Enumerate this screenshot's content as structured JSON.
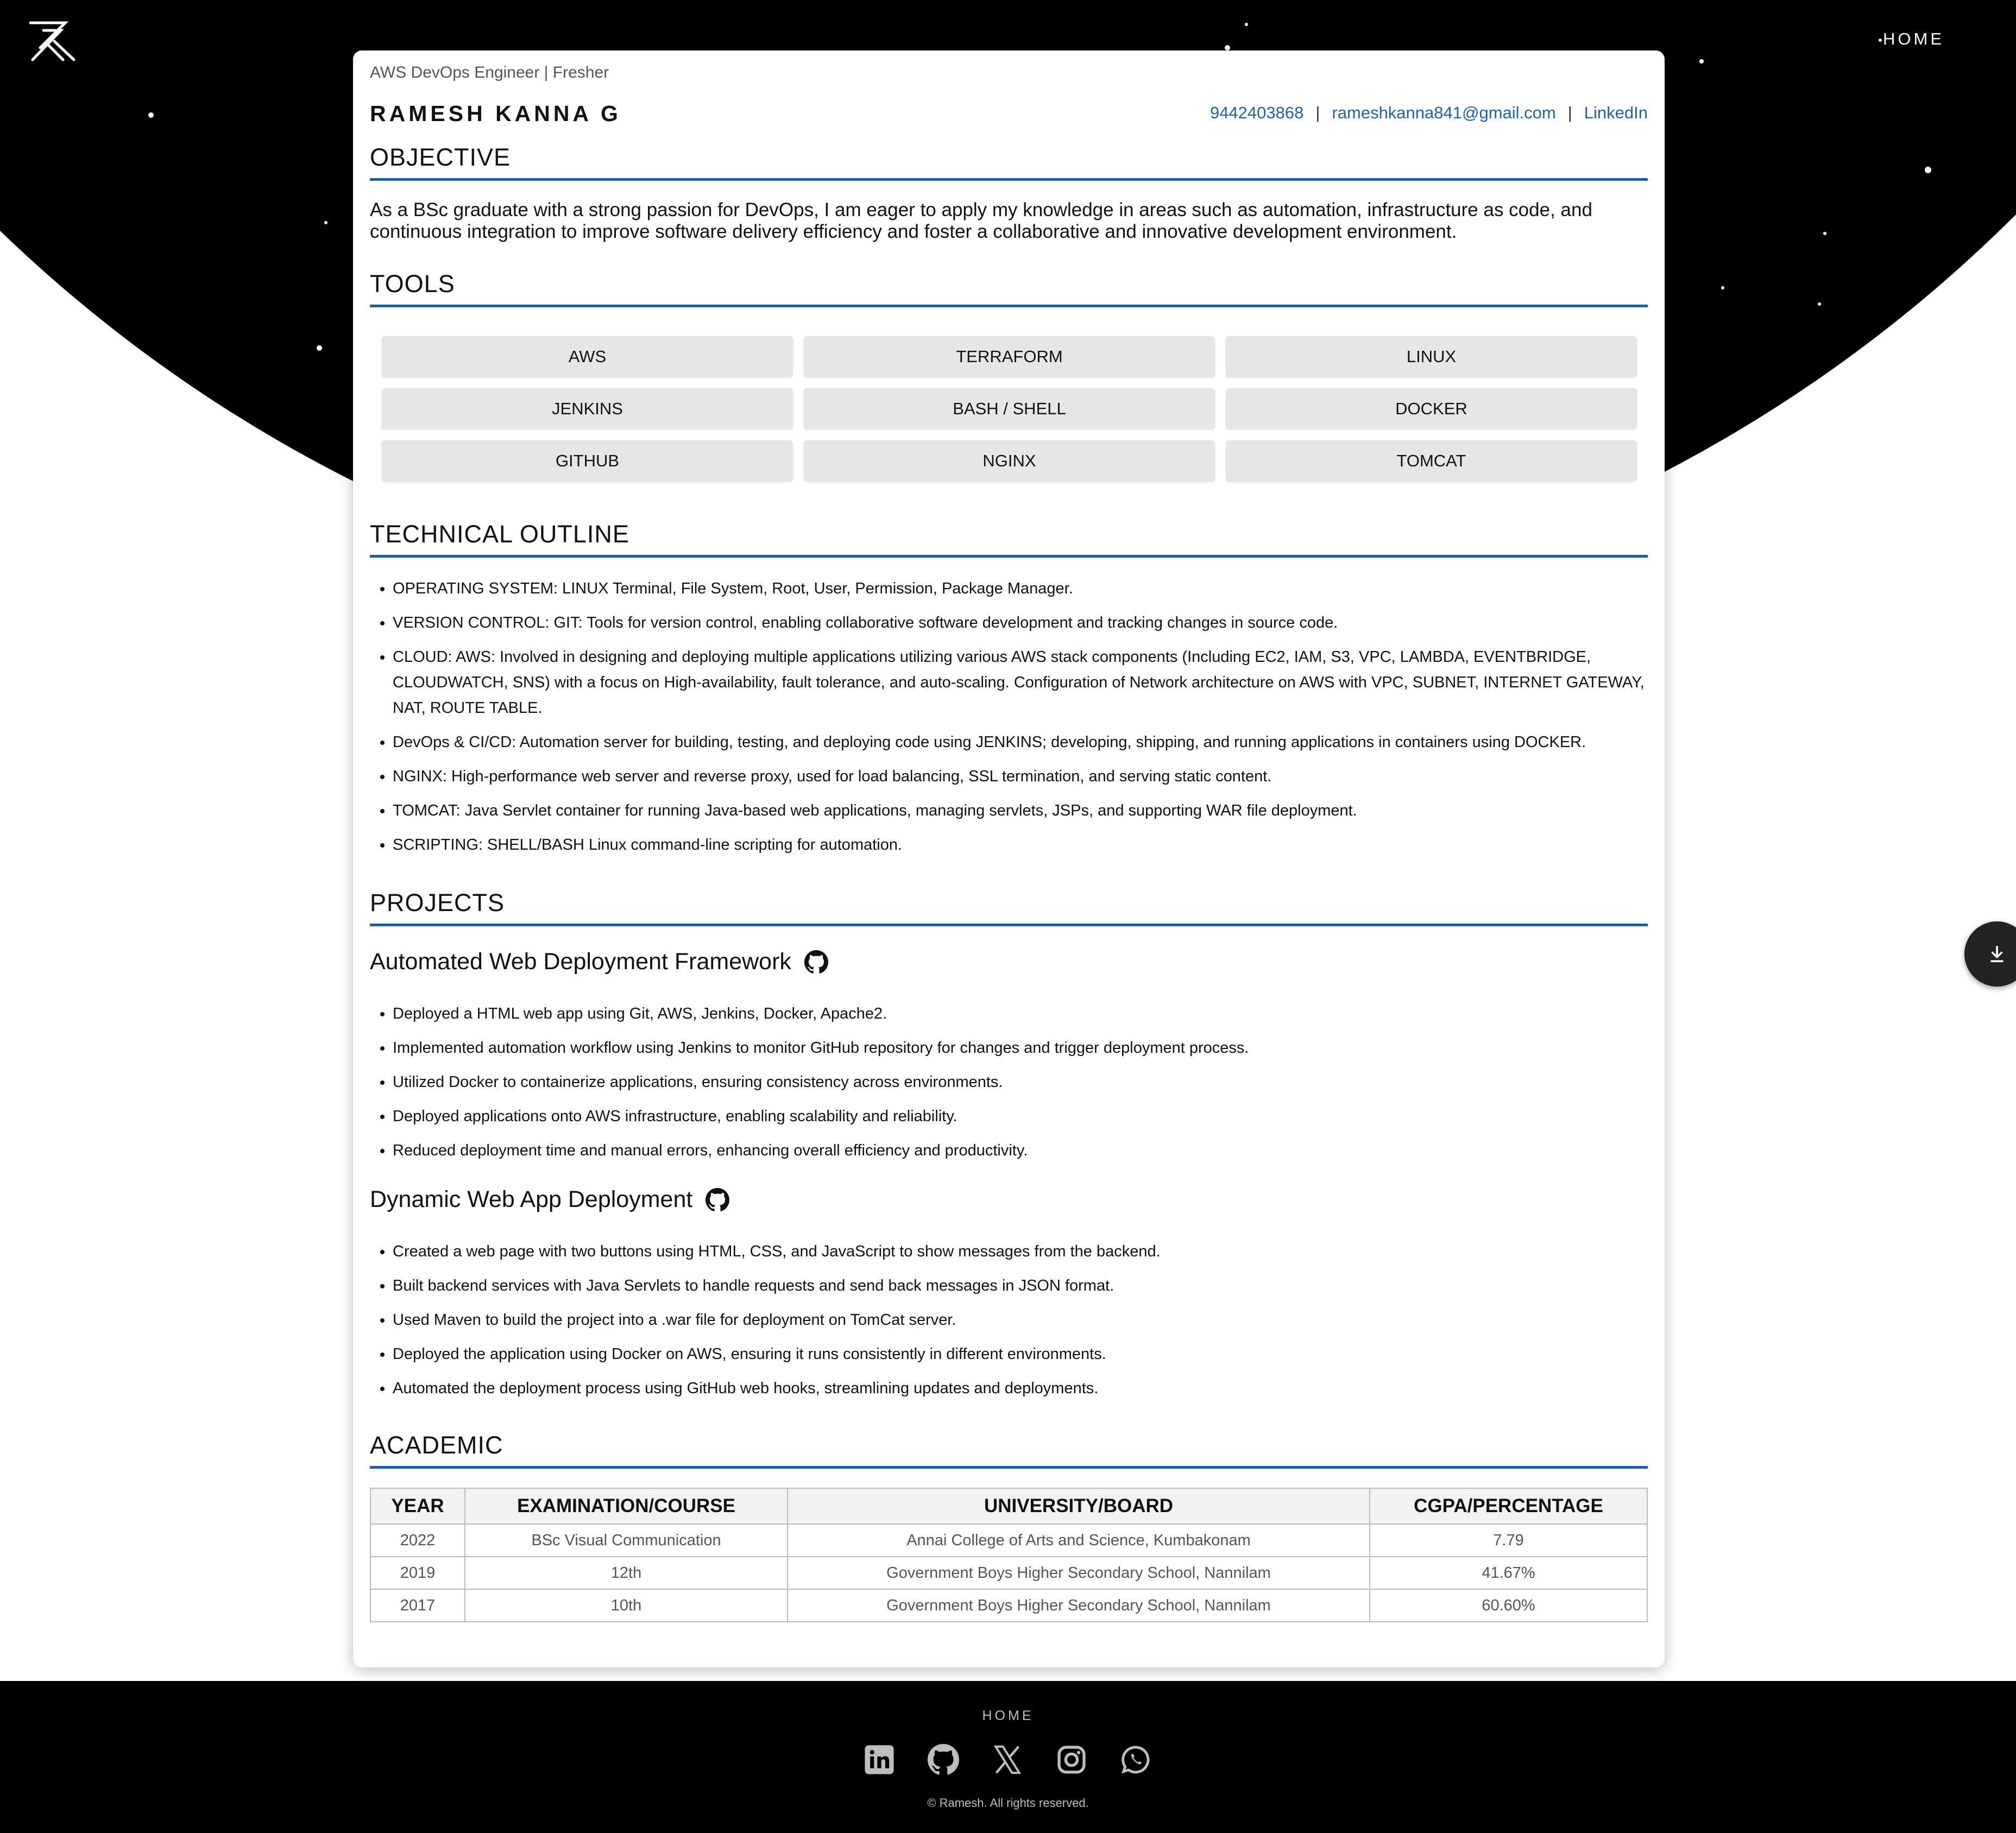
{
  "nav": {
    "home_label": "HOME"
  },
  "header": {
    "role": "AWS DevOps Engineer | Fresher",
    "name": "RAMESH KANNA G",
    "phone": "9442403868",
    "email": "rameshkanna841@gmail.com",
    "linkedin": "LinkedIn",
    "separator": "|"
  },
  "objective": {
    "title": "OBJECTIVE",
    "text": "As a BSc graduate with a strong passion for DevOps, I am eager to apply my knowledge in areas such as automation, infrastructure as code, and continuous integration to improve software delivery efficiency and foster a collaborative and innovative development environment."
  },
  "tools": {
    "title": "TOOLS",
    "items": [
      "AWS",
      "TERRAFORM",
      "LINUX",
      "JENKINS",
      "BASH / SHELL",
      "DOCKER",
      "GITHUB",
      "NGINX",
      "TOMCAT"
    ]
  },
  "technical": {
    "title": "TECHNICAL OUTLINE",
    "items": [
      "OPERATING SYSTEM: LINUX Terminal, File System, Root, User, Permission, Package Manager.",
      "VERSION CONTROL: GIT: Tools for version control, enabling collaborative software development and tracking changes in source code.",
      "CLOUD: AWS: Involved in designing and deploying multiple applications utilizing various AWS stack components (Including EC2, IAM, S3, VPC, LAMBDA, EVENTBRIDGE, CLOUDWATCH, SNS) with a focus on High-availability, fault tolerance, and auto-scaling. Configuration of Network architecture on AWS with VPC, SUBNET, INTERNET GATEWAY, NAT, ROUTE TABLE.",
      "DevOps & CI/CD: Automation server for building, testing, and deploying code using JENKINS; developing, shipping, and running applications in containers using DOCKER.",
      "NGINX: High-performance web server and reverse proxy, used for load balancing, SSL termination, and serving static content.",
      "TOMCAT: Java Servlet container for running Java-based web applications, managing servlets, JSPs, and supporting WAR file deployment.",
      "SCRIPTING: SHELL/BASH Linux command-line scripting for automation."
    ]
  },
  "projects": {
    "title": "PROJECTS",
    "list": [
      {
        "name": "Automated Web Deployment Framework",
        "items": [
          "Deployed a HTML web app using Git, AWS, Jenkins, Docker, Apache2.",
          "Implemented automation workflow using Jenkins to monitor GitHub repository for changes and trigger deployment process.",
          "Utilized Docker to containerize applications, ensuring consistency across environments.",
          "Deployed applications onto AWS infrastructure, enabling scalability and reliability.",
          "Reduced deployment time and manual errors, enhancing overall efficiency and productivity."
        ]
      },
      {
        "name": "Dynamic Web App Deployment",
        "items": [
          "Created a web page with two buttons using HTML, CSS, and JavaScript to show messages from the backend.",
          "Built backend services with Java Servlets to handle requests and send back messages in JSON format.",
          "Used Maven to build the project into a .war file for deployment on TomCat server.",
          "Deployed the application using Docker on AWS, ensuring it runs consistently in different environments.",
          "Automated the deployment process using GitHub web hooks, streamlining updates and deployments."
        ]
      }
    ]
  },
  "academic": {
    "title": "ACADEMIC",
    "headers": [
      "YEAR",
      "EXAMINATION/COURSE",
      "UNIVERSITY/BOARD",
      "CGPA/PERCENTAGE"
    ],
    "rows": [
      [
        "2022",
        "BSc Visual Communication",
        "Annai College of Arts and Science, Kumbakonam",
        "7.79"
      ],
      [
        "2019",
        "12th",
        "Government Boys Higher Secondary School, Nannilam",
        "41.67%"
      ],
      [
        "2017",
        "10th",
        "Government Boys Higher Secondary School, Nannilam",
        "60.60%"
      ]
    ]
  },
  "footer": {
    "home_label": "HOME",
    "copyright": "© Ramesh. All rights reserved.",
    "socials": [
      "linkedin-icon",
      "github-icon",
      "x-icon",
      "instagram-icon",
      "whatsapp-icon"
    ]
  },
  "icons": {
    "download": "download-icon",
    "logo": "rk-logo"
  },
  "colors": {
    "accent": "#1b5fa6",
    "link": "#1d64a8",
    "background": "#000000",
    "tool_bg": "#e6e6e6"
  }
}
